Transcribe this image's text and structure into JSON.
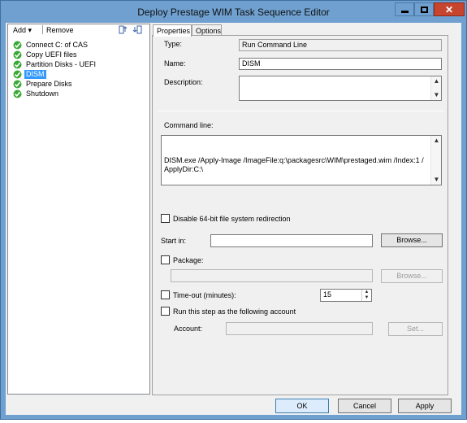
{
  "window": {
    "title": "Deploy Prestage WIM Task Sequence Editor"
  },
  "toolbar": {
    "add_label": "Add",
    "add_arrow": "▾",
    "remove_label": "Remove"
  },
  "tree": {
    "items": [
      {
        "label": "Connect C: of CAS",
        "icon": "green-check-icon"
      },
      {
        "label": "Copy UEFI files",
        "icon": "green-check-icon"
      },
      {
        "label": "Partition Disks - UEFI",
        "icon": "green-check-icon"
      },
      {
        "label": "DISM",
        "icon": "green-check-icon",
        "selected": true
      },
      {
        "label": "Prepare Disks",
        "icon": "green-check-icon"
      },
      {
        "label": "Shutdown",
        "icon": "green-check-icon"
      }
    ]
  },
  "tabs": [
    {
      "label": "Properties",
      "active": true
    },
    {
      "label": "Options",
      "active": false
    }
  ],
  "properties": {
    "type_label": "Type:",
    "type_value": "Run Command Line",
    "name_label": "Name:",
    "name_value": "DISM",
    "description_label": "Description:",
    "description_value": "",
    "command_line_label": "Command line:",
    "command_line_value": "DISM.exe /Apply-Image /ImageFile:q:\\packagesrc\\WIM\\prestaged.wim /Index:1 /ApplyDir:C:\\",
    "disable_redirection_label": "Disable 64-bit file system redirection",
    "start_in_label": "Start in:",
    "start_in_value": "",
    "browse_label": "Browse...",
    "package_label": "Package:",
    "package_value": "",
    "package_browse_label": "Browse...",
    "timeout_label": "Time-out (minutes):",
    "timeout_value": "15",
    "run_as_label": "Run this step as the following account",
    "account_label": "Account:",
    "account_value": "",
    "set_label": "Set..."
  },
  "footer": {
    "ok_label": "OK",
    "cancel_label": "Cancel",
    "apply_label": "Apply"
  },
  "colors": {
    "titlebar": "#6fa0d0",
    "close_button": "#c7452f",
    "selection": "#3399ff",
    "check_green": "#3aa935"
  }
}
